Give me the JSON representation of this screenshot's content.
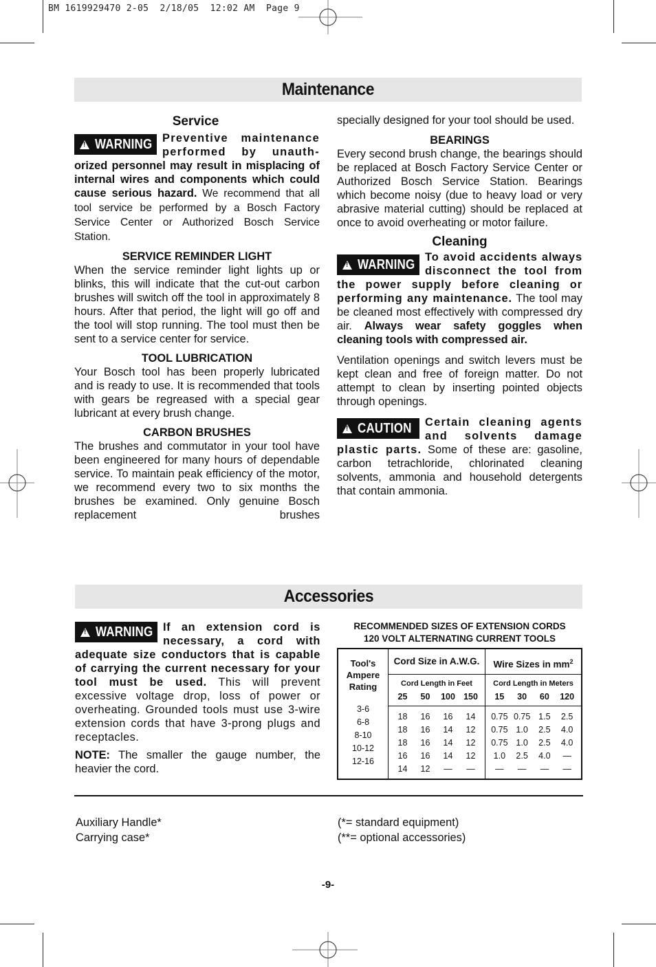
{
  "slug": "BM 1619929470 2-05  2/18/05  12:02 AM  Page 9",
  "maintenance": {
    "title": "Maintenance",
    "service": {
      "title": "Service",
      "warning_label": "WARNING",
      "warning_bold_1": "Preventive maintenance performed by unauth-",
      "warning_bold_2": "orized personnel may result in misplacing of internal wires and components which could cause serious hazard.",
      "body": " We recommend that all tool service be performed by a Bosch Factory Service Center or Authorized Bosch Service Station."
    },
    "reminder": {
      "title": "SERVICE REMINDER LIGHT",
      "body": "When the service reminder light lights up or blinks, this will indicate that the cut-out carbon brushes will switch off the tool in approximately 8 hours.  After that period, the light will go off and the tool will stop running. The tool must then be sent to a service center for service."
    },
    "lubrication": {
      "title": "TOOL LUBRICATION",
      "body": "Your Bosch tool has been properly lubricated and is ready to use. It is recommended that tools with gears be regreased with a special gear lubricant at every brush change."
    },
    "brushes": {
      "title": "CARBON BRUSHES",
      "body": "The brushes and commutator in your tool have been engineered for many hours of dependable service. To maintain peak efficiency of the motor, we recommend every two to six months the brushes be examined. Only genuine Bosch replacement brushes",
      "body_cont": "specially designed for your tool should be used."
    },
    "bearings": {
      "title": "BEARINGS",
      "body": "Every second brush change, the bearings should be replaced at Bosch Factory Service Center or Authorized Bosch Service Station. Bearings which become noisy (due to heavy load or very abrasive material cutting) should be replaced at once to avoid overheating or motor failure."
    },
    "cleaning": {
      "title": "Cleaning",
      "warning_label": "WARNING",
      "warning_bold": "To avoid accidents always disconnect the tool from the power supply before cleaning or performing any maintenance.",
      "body_1": " The tool may be cleaned most effectively with compressed dry air. ",
      "bold_2": "Always wear safety goggles when cleaning tools with compressed air.",
      "ventilation": "Ventilation openings and switch levers must be kept clean and free of foreign matter. Do not attempt to clean by inserting pointed objects through openings.",
      "caution_label": "CAUTION",
      "caution_bold": "Certain cleaning agents and solvents damage plastic parts.",
      "caution_body": " Some of these are: gasoline, carbon tetrachloride, chlorinated cleaning solvents, ammonia and household detergents that contain ammonia."
    }
  },
  "accessories": {
    "title": "Accessories",
    "warning_label": "WARNING",
    "warning_bold": "If an extension cord is necessary, a cord with adequate size conductors that is capable of carrying the current necessary for your tool must be used.",
    "warning_body": " This will prevent excessive voltage drop, loss of power or overheating. Grounded tools must use 3-wire extension cords that have 3-prong plugs and receptacles.",
    "note_label": "NOTE:",
    "note_body": " The smaller the gauge number, the heavier the cord.",
    "table": {
      "title_1": "RECOMMENDED SIZES OF EXTENSION CORDS",
      "title_2": "120 VOLT ALTERNATING CURRENT TOOLS",
      "col_rating": "Tool's Ampere Rating",
      "col_awg": "Cord Size in A.W.G.",
      "col_mm": "Wire Sizes in mm",
      "col_mm_sup": "2",
      "sub_feet": "Cord Length in Feet",
      "sub_meters": "Cord Length in Meters",
      "feet": [
        "25",
        "50",
        "100",
        "150"
      ],
      "meters": [
        "15",
        "30",
        "60",
        "120"
      ],
      "rows": [
        {
          "rating": "3-6",
          "awg": [
            "18",
            "16",
            "16",
            "14"
          ],
          "mm": [
            "0.75",
            "0.75",
            "1.5",
            "2.5"
          ]
        },
        {
          "rating": "6-8",
          "awg": [
            "18",
            "16",
            "14",
            "12"
          ],
          "mm": [
            "0.75",
            "1.0",
            "2.5",
            "4.0"
          ]
        },
        {
          "rating": "8-10",
          "awg": [
            "18",
            "16",
            "14",
            "12"
          ],
          "mm": [
            "0.75",
            "1.0",
            "2.5",
            "4.0"
          ]
        },
        {
          "rating": "10-12",
          "awg": [
            "16",
            "16",
            "14",
            "12"
          ],
          "mm": [
            "1.0",
            "2.5",
            "4.0",
            "—"
          ]
        },
        {
          "rating": "12-16",
          "awg": [
            "14",
            "12",
            "—",
            "—"
          ],
          "mm": [
            "—",
            "—",
            "—",
            "—"
          ]
        }
      ]
    },
    "items": [
      "Auxiliary Handle*",
      "Carrying case*"
    ],
    "legend": [
      "(*= standard equipment)",
      "(**= optional accessories)"
    ]
  },
  "page_number": "-9-"
}
